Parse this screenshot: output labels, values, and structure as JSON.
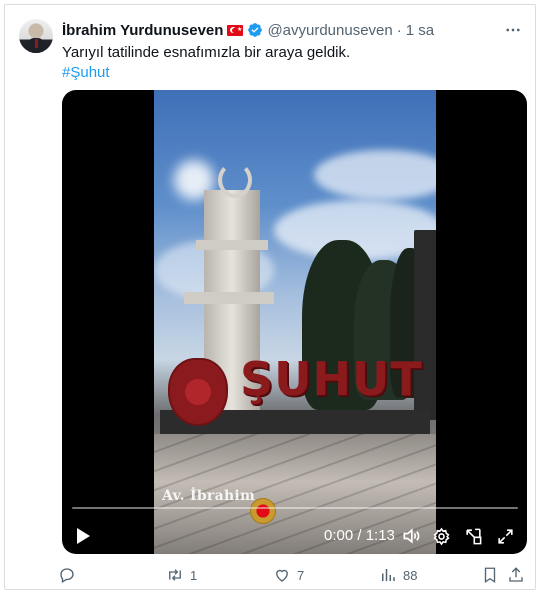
{
  "author": {
    "name": "İbrahim Yurdunuseven",
    "handle": "@avyurdunuseven",
    "separator": "·",
    "time": "1 sa"
  },
  "tweet": {
    "text": "Yarıyıl tatilinde esnafımızla bir araya geldik.",
    "hashtag": "#Şuhut"
  },
  "video": {
    "sign_text": "ŞUHUT",
    "watermark": "Av. İbrahim",
    "timecode": "0:00 / 1:13",
    "progress": 0
  },
  "actions": {
    "replies": "",
    "retweets": "1",
    "likes": "7",
    "views": "88"
  },
  "colors": {
    "accent": "#1d9bf0",
    "muted": "#536471",
    "text": "#0f1419",
    "flag_red": "#e30a17"
  },
  "icons": [
    "verified-icon",
    "more-icon",
    "play-icon",
    "volume-icon",
    "settings-icon",
    "pip-icon",
    "fullscreen-icon",
    "reply-icon",
    "retweet-icon",
    "like-icon",
    "views-icon",
    "bookmark-icon",
    "share-icon"
  ]
}
